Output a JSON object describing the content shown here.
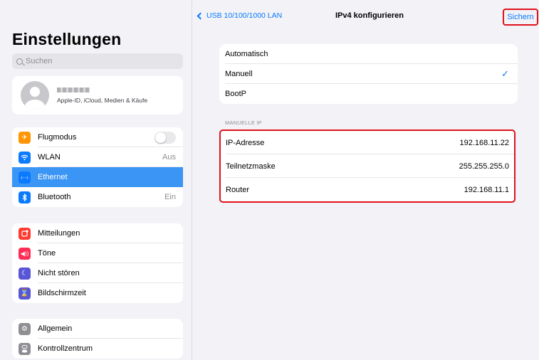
{
  "sidebar": {
    "title": "Einstellungen",
    "search_placeholder": "Suchen",
    "profile_subtitle": "Apple-ID, iCloud, Medien & Käufe",
    "groups": [
      {
        "items": [
          {
            "label": "Flugmodus",
            "value": "",
            "icon": "airplane-icon",
            "color": "#ff9500"
          },
          {
            "label": "WLAN",
            "value": "Aus",
            "icon": "wifi-icon",
            "color": "#0a7aff"
          },
          {
            "label": "Ethernet",
            "value": "",
            "icon": "ethernet-icon",
            "color": "#0a7aff",
            "active": true
          },
          {
            "label": "Bluetooth",
            "value": "Ein",
            "icon": "bluetooth-icon",
            "color": "#0a7aff"
          }
        ]
      },
      {
        "items": [
          {
            "label": "Mitteilungen",
            "icon": "notifications-icon",
            "color": "#ff3b30"
          },
          {
            "label": "Töne",
            "icon": "sounds-icon",
            "color": "#ff2d55"
          },
          {
            "label": "Nicht stören",
            "icon": "moon-icon",
            "color": "#5856d6"
          },
          {
            "label": "Bildschirmzeit",
            "icon": "hourglass-icon",
            "color": "#5856d6"
          }
        ]
      },
      {
        "items": [
          {
            "label": "Allgemein",
            "icon": "gear-icon",
            "color": "#8e8e93"
          },
          {
            "label": "Kontrollzentrum",
            "icon": "toggles-icon",
            "color": "#8e8e93"
          }
        ]
      }
    ]
  },
  "nav": {
    "back_label": "USB 10/100/1000 LAN",
    "title": "IPv4 konfigurieren",
    "save_label": "Sichern"
  },
  "config_options": [
    {
      "label": "Automatisch",
      "selected": false
    },
    {
      "label": "Manuell",
      "selected": true
    },
    {
      "label": "BootP",
      "selected": false
    }
  ],
  "manual_ip": {
    "header": "MANUELLE IP",
    "rows": [
      {
        "label": "IP-Adresse",
        "value": "192.168.11.22"
      },
      {
        "label": "Teilnetzmaske",
        "value": "255.255.255.0"
      },
      {
        "label": "Router",
        "value": "192.168.11.1"
      }
    ]
  },
  "colors": {
    "accent": "#0a7aff",
    "selection": "#3a95f5",
    "highlight_border": "#e0121b"
  }
}
